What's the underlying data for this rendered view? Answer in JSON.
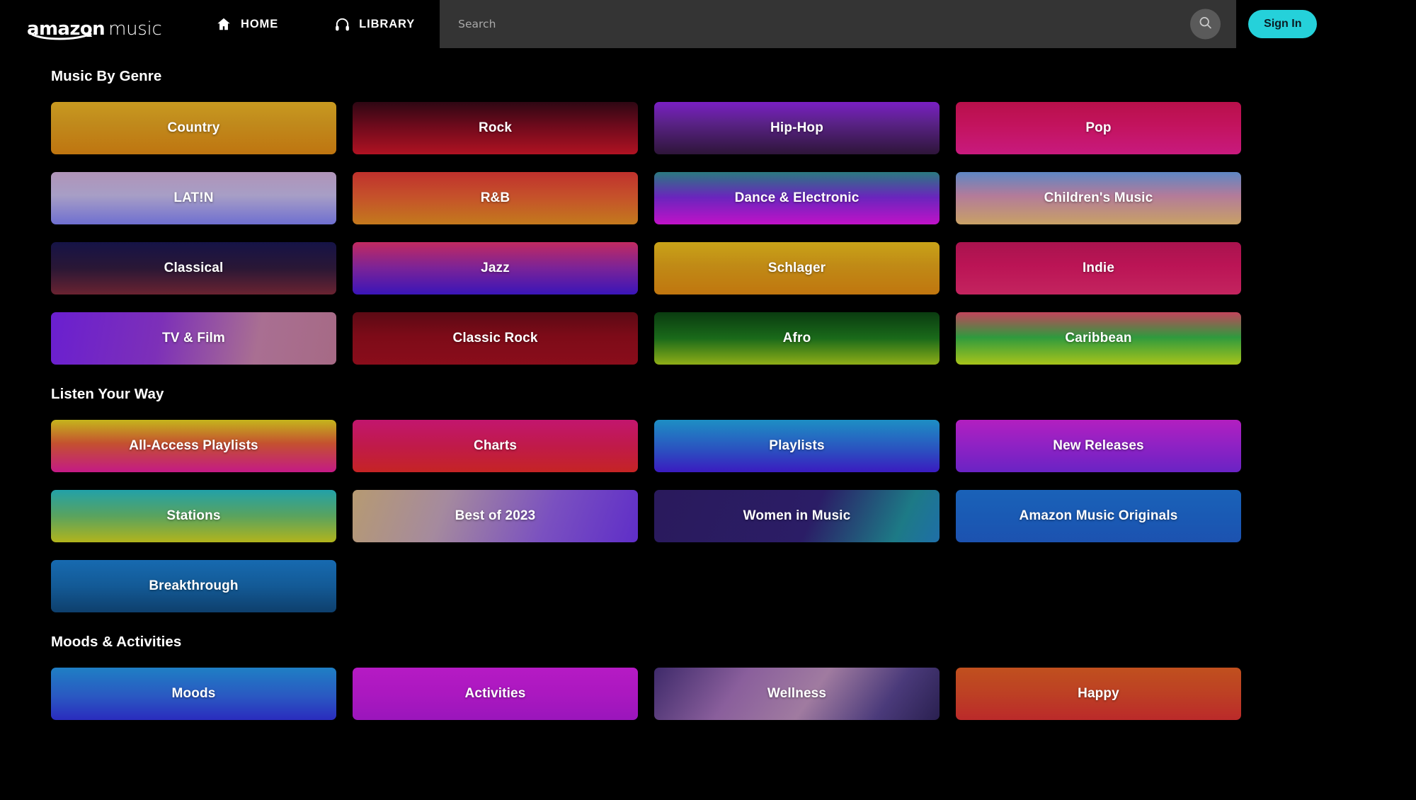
{
  "nav": {
    "logo_amazon": "amazon",
    "logo_music": "music",
    "home_label": "HOME",
    "library_label": "LIBRARY",
    "signin_label": "Sign In"
  },
  "search": {
    "placeholder": "Search",
    "value": ""
  },
  "colors": {
    "accent": "#25D1DA",
    "background": "#000000",
    "search_background": "#343434",
    "search_button": "#5a5a5a",
    "text": "#ffffff"
  },
  "sections": [
    {
      "title": "Music By Genre",
      "tiles": [
        {
          "label": "Country",
          "gradient": "linear-gradient(180deg,#c99a20 0%,#c08a1c 40%,#bf7510 100%)"
        },
        {
          "label": "Rock",
          "gradient": "linear-gradient(180deg,#2e0713 0%,#6d0a1c 45%,#b01222 100%)"
        },
        {
          "label": "Hip-Hop",
          "gradient": "linear-gradient(180deg,#7a1fc4 0%,#5a2287 40%,#2e1539 100%)"
        },
        {
          "label": "Pop",
          "gradient": "linear-gradient(180deg,#b8104a 0%,#c3135e 45%,#c81a7e 100%)"
        },
        {
          "label": "LAT!N",
          "gradient": "linear-gradient(180deg,#b094b8 0%,#a79ec6 45%,#6f6fd0 100%)"
        },
        {
          "label": "R&B",
          "gradient": "linear-gradient(180deg,#c0312c 0%,#c5502b 45%,#c4791d 100%)"
        },
        {
          "label": "Dance & Electronic",
          "gradient": "linear-gradient(180deg,#2a7a80 0%,#6a25bd 48%,#c112c8 100%)"
        },
        {
          "label": "Children's Music",
          "gradient": "linear-gradient(180deg,#5e87c4 0%,#b37b9a 45%,#c8a165 100%)"
        },
        {
          "label": "Classical",
          "gradient": "linear-gradient(180deg,#151347 0%,#2a1735 50%,#6a2331 100%)"
        },
        {
          "label": "Jazz",
          "gradient": "linear-gradient(180deg,#c22a60 0%,#7a2398 50%,#3a15b8 100%)"
        },
        {
          "label": "Schlager",
          "gradient": "linear-gradient(180deg,#c9a318 0%,#c08a16 45%,#c0760f 100%)"
        },
        {
          "label": "Indie",
          "gradient": "linear-gradient(180deg,#a8134e 0%,#bb1455 45%,#c3245f 100%)"
        },
        {
          "label": "TV & Film",
          "gradient": "linear-gradient(100deg,#6a1fd0 0%,#7d30b8 38%,#a96f92 72%,#a66a85 100%)"
        },
        {
          "label": "Classic Rock",
          "gradient": "linear-gradient(180deg,#5b0a14 0%,#7d0b18 45%,#8a0d1b 100%)"
        },
        {
          "label": "Afro",
          "gradient": "linear-gradient(180deg,#0a3b10 0%,#1a6a1a 50%,#8fae17 100%)"
        },
        {
          "label": "Caribbean",
          "gradient": "linear-gradient(180deg,#c2455c 0%,#2f9a3e 48%,#a8c41a 100%)"
        }
      ]
    },
    {
      "title": "Listen Your Way",
      "tiles": [
        {
          "label": "All-Access Playlists",
          "gradient": "linear-gradient(180deg,#c5b51c 0%,#c4512f 45%,#c41a86 100%)"
        },
        {
          "label": "Charts",
          "gradient": "linear-gradient(180deg,#c2166e 0%,#c01a4a 50%,#c52424 100%)"
        },
        {
          "label": "Playlists",
          "gradient": "linear-gradient(180deg,#1d8fc4 0%,#2a54c0 55%,#3a1bc0 100%)"
        },
        {
          "label": "New Releases",
          "gradient": "linear-gradient(180deg,#b31fc0 0%,#8e22c4 50%,#6a23c4 100%)"
        },
        {
          "label": "Stations",
          "gradient": "linear-gradient(180deg,#22a1a8 0%,#5aa35e 50%,#b2b41c 100%)"
        },
        {
          "label": "Best of 2023",
          "gradient": "linear-gradient(110deg,#b69a72 0%,#a58a9e 32%,#7a50c0 68%,#5f2ec8 100%)"
        },
        {
          "label": "Women in Music",
          "gradient": "linear-gradient(115deg,#2a1a5c 0%,#2b1d66 55%,#1d7a86 85%,#1f6fa8 100%)"
        },
        {
          "label": "Amazon Music Originals",
          "gradient": "linear-gradient(180deg,#1a62b8 0%,#1a5ab4 50%,#1c52b0 100%)"
        },
        {
          "label": "Breakthrough",
          "gradient": "linear-gradient(180deg,#176ab0 0%,#135a96 50%,#0e3f6c 100%)"
        }
      ]
    },
    {
      "title": "Moods & Activities",
      "tiles": [
        {
          "label": "Moods",
          "gradient": "linear-gradient(180deg,#1f7fc4 0%,#2a58c2 55%,#2a2cbe 100%)"
        },
        {
          "label": "Activities",
          "gradient": "linear-gradient(180deg,#b61ac4 0%,#ab18c0 50%,#9a16bc 100%)"
        },
        {
          "label": "Wellness",
          "gradient": "linear-gradient(125deg,#3e2a6a 0%,#8a5f9c 30%,#a07ba0 55%,#4a3a7a 80%,#2a2050 100%)"
        },
        {
          "label": "Happy",
          "gradient": "linear-gradient(180deg,#c0501e 0%,#bd4024 50%,#bb2a2a 100%)"
        }
      ]
    }
  ],
  "icons": {
    "home": "home-icon",
    "library": "headphones-icon",
    "search": "search-icon"
  }
}
